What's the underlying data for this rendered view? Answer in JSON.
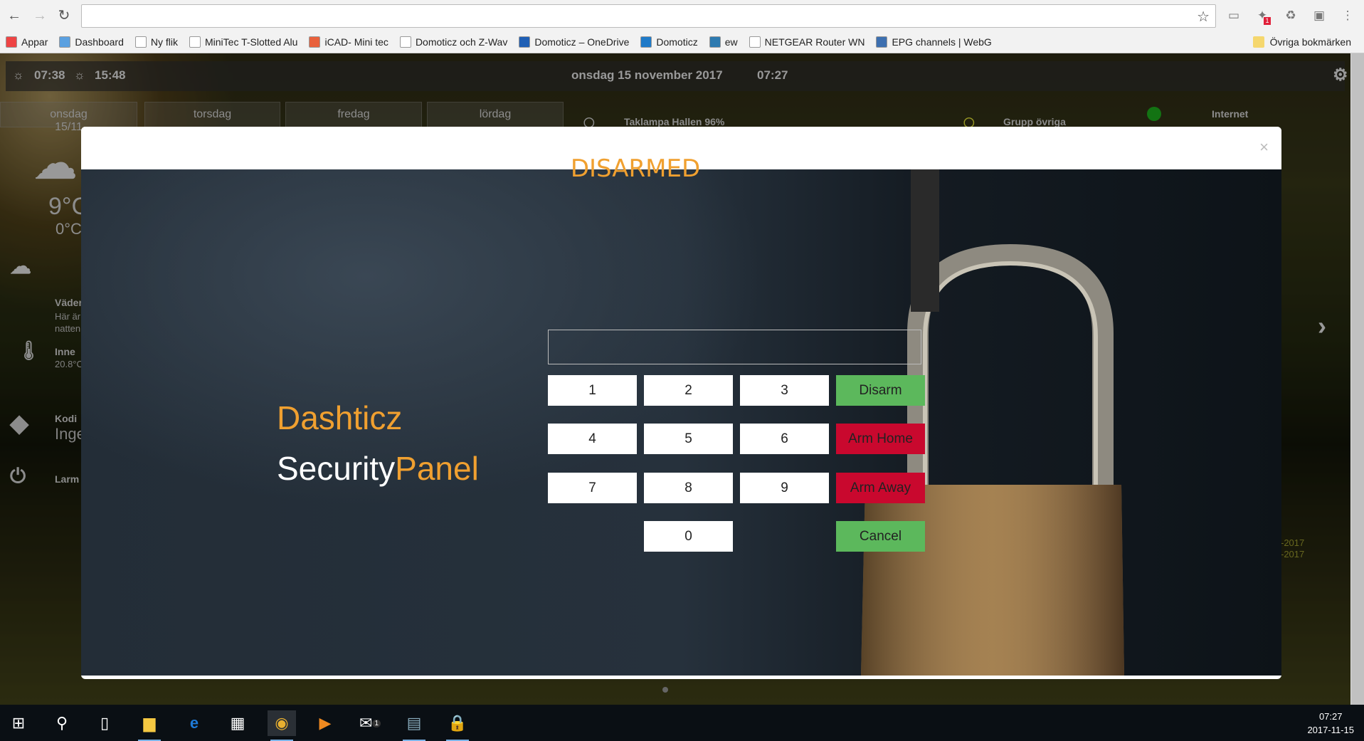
{
  "browser": {
    "address": "",
    "bookmarks": [
      {
        "label": "Appar",
        "icon": "apps-grid-icon",
        "color": "#e44"
      },
      {
        "label": "Dashboard",
        "icon": "nsys-icon",
        "color": "#5aa0e0"
      },
      {
        "label": "Ny flik",
        "icon": "page-icon",
        "color": "#fff"
      },
      {
        "label": "MiniTec T-Slotted Alu",
        "icon": "minitec-icon",
        "color": "#fff"
      },
      {
        "label": "iCAD- Mini tec",
        "icon": "icad-icon",
        "color": "#e8603c"
      },
      {
        "label": "Domoticz och Z-Wav",
        "icon": "domoticz-house-icon",
        "color": "#fff"
      },
      {
        "label": "Domoticz – OneDrive",
        "icon": "onedrive-icon",
        "color": "#1f5fb5"
      },
      {
        "label": "Domoticz",
        "icon": "domoticz-icon",
        "color": "#1f7ac8"
      },
      {
        "label": "ew",
        "icon": "wordpress-icon",
        "color": "#2d7ab0"
      },
      {
        "label": "NETGEAR Router WN",
        "icon": "page-icon",
        "color": "#fff"
      },
      {
        "label": "EPG channels | WebG",
        "icon": "webg-icon",
        "color": "#3d6fb0"
      }
    ],
    "other_bookmarks": "Övriga bokmärken",
    "ext_badge": "1"
  },
  "dashboard": {
    "sunrise": "07:38",
    "sunset": "15:48",
    "date": "onsdag 15 november 2017",
    "time": "07:27",
    "days": [
      "onsdag",
      "torsdag",
      "fredag",
      "lördag"
    ],
    "today_date": "15/11",
    "temp_high": "9°C",
    "temp_low": "0°C",
    "devices": [
      {
        "label": "Taklampa Hallen 96%"
      },
      {
        "label": "Grupp övriga"
      },
      {
        "label": "Internet"
      }
    ],
    "side": [
      {
        "title": "Väder",
        "text": "Här är",
        "text2": "natten"
      },
      {
        "title": "Inne",
        "text": "20.8°C"
      },
      {
        "title": "Kodi",
        "text": "Inget"
      },
      {
        "title": "Larm"
      }
    ],
    "dates": [
      "-2017",
      "-2017"
    ]
  },
  "modal": {
    "close": "×",
    "status": "DISARMED",
    "code_value": "",
    "brand1": "Dashticz",
    "brand2a": "Security",
    "brand2b": "Panel",
    "keys": [
      "1",
      "2",
      "3",
      "4",
      "5",
      "6",
      "7",
      "8",
      "9",
      "0"
    ],
    "actions": {
      "disarm": "Disarm",
      "arm_home": "Arm Home",
      "arm_away": "Arm Away",
      "cancel": "Cancel"
    },
    "colors": {
      "accent": "#f0a030",
      "green": "#5cb85c",
      "red": "#c9082e"
    }
  },
  "taskbar": {
    "time": "07:27",
    "date": "2017-11-15",
    "mail_badge": "1"
  }
}
